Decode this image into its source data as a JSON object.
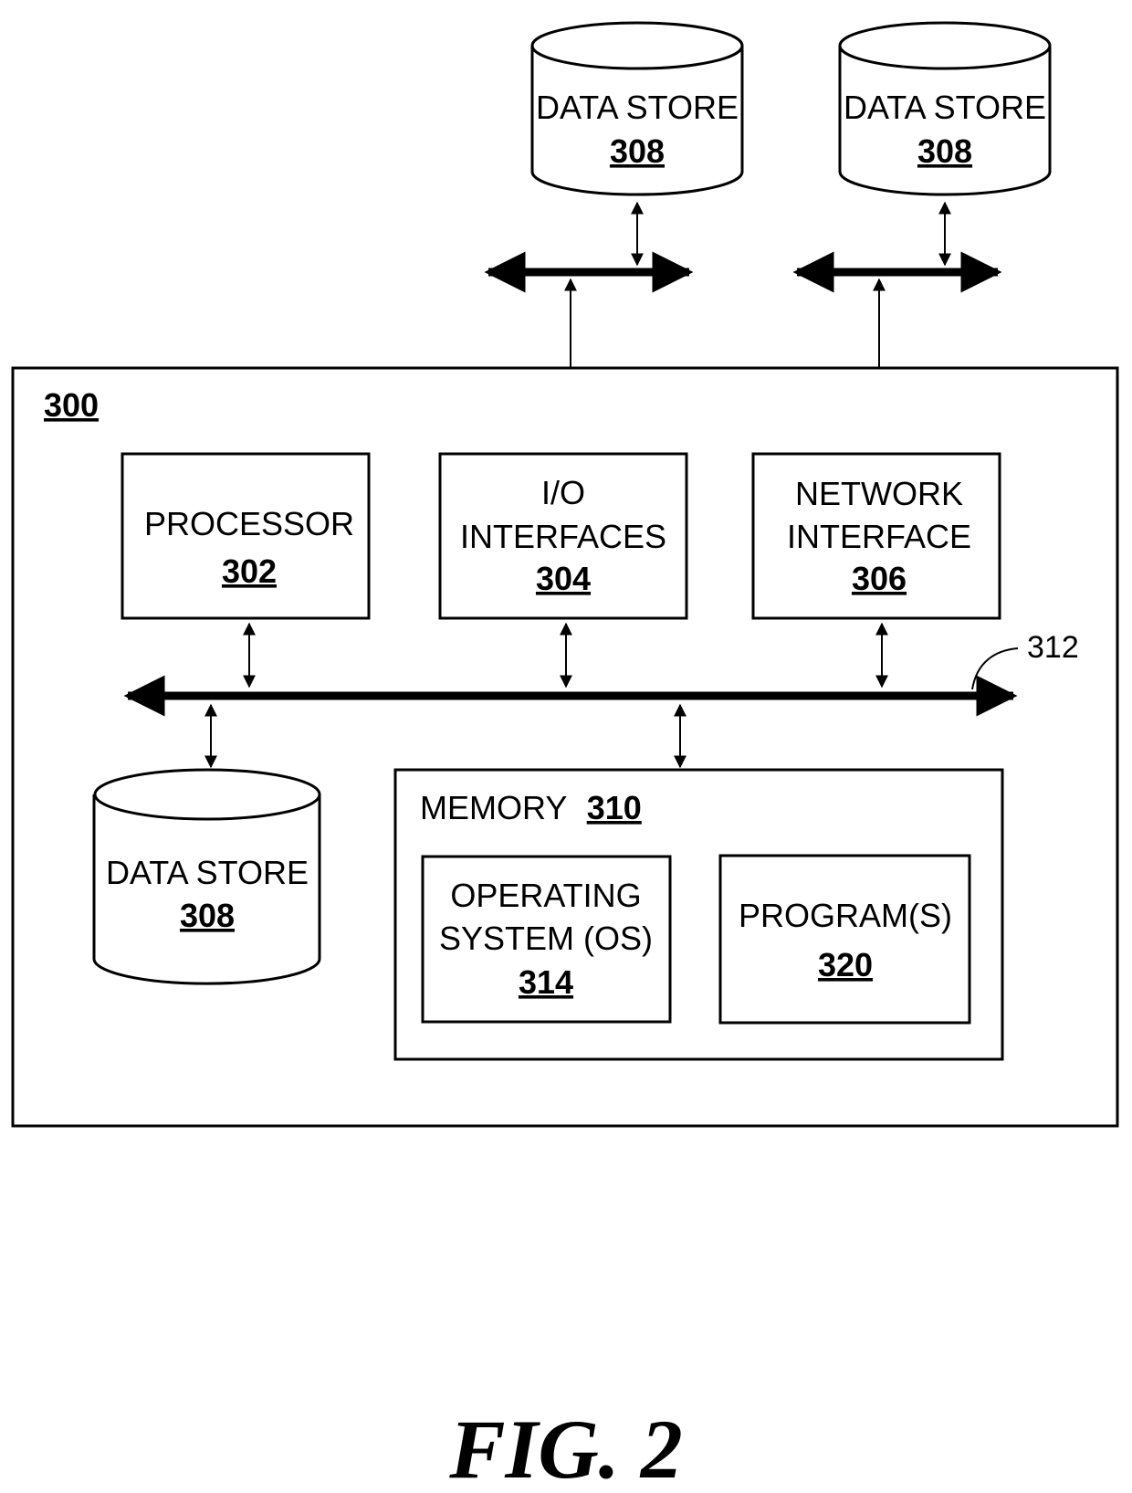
{
  "figure": {
    "caption": "FIG. 2",
    "system": {
      "ref": "300"
    },
    "bus": {
      "ref": "312"
    },
    "external_data_stores": [
      {
        "label": "DATA STORE",
        "ref": "308"
      },
      {
        "label": "DATA STORE",
        "ref": "308"
      }
    ],
    "components": {
      "processor": {
        "lines": [
          "PROCESSOR"
        ],
        "ref": "302"
      },
      "io_interfaces": {
        "lines": [
          "I/O",
          "INTERFACES"
        ],
        "ref": "304"
      },
      "network_interface": {
        "lines": [
          "NETWORK",
          "INTERFACE"
        ],
        "ref": "306"
      }
    },
    "internal_data_store": {
      "label": "DATA STORE",
      "ref": "308"
    },
    "memory": {
      "label": "MEMORY",
      "ref": "310",
      "operating_system": {
        "lines": [
          "OPERATING",
          "SYSTEM (OS)"
        ],
        "ref": "314"
      },
      "programs": {
        "lines": [
          "PROGRAM(S)"
        ],
        "ref": "320"
      }
    }
  }
}
